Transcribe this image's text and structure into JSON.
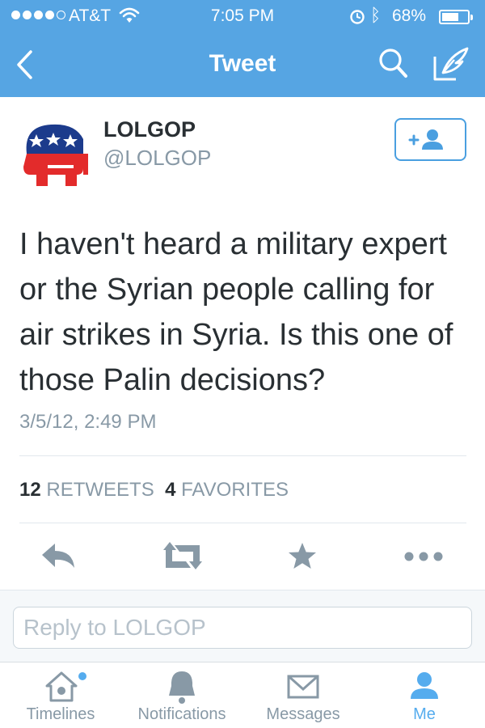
{
  "status_bar": {
    "carrier": "AT&T",
    "time": "7:05 PM",
    "battery_percent": "68%",
    "battery_level": 0.68
  },
  "nav": {
    "title": "Tweet"
  },
  "tweet": {
    "display_name": "LOLGOP",
    "handle": "@LOLGOP",
    "text": "I haven't heard a military expert or the Syrian people calling for air strikes in Syria. Is this one of those Palin decisions?",
    "timestamp": "3/5/12, 2:49 PM",
    "retweets_count": "12",
    "retweets_label": "RETWEETS",
    "favorites_count": "4",
    "favorites_label": "FAVORITES"
  },
  "reply": {
    "placeholder": "Reply to LOLGOP"
  },
  "tabs": [
    {
      "label": "Timelines",
      "icon": "home-icon",
      "active": false
    },
    {
      "label": "Notifications",
      "icon": "bell-icon",
      "active": false
    },
    {
      "label": "Messages",
      "icon": "envelope-icon",
      "active": false
    },
    {
      "label": "Me",
      "icon": "person-icon",
      "active": true
    }
  ],
  "colors": {
    "brand_blue": "#55acee",
    "nav_bar": "#56a5e3",
    "icon_gray": "#8899a6"
  }
}
